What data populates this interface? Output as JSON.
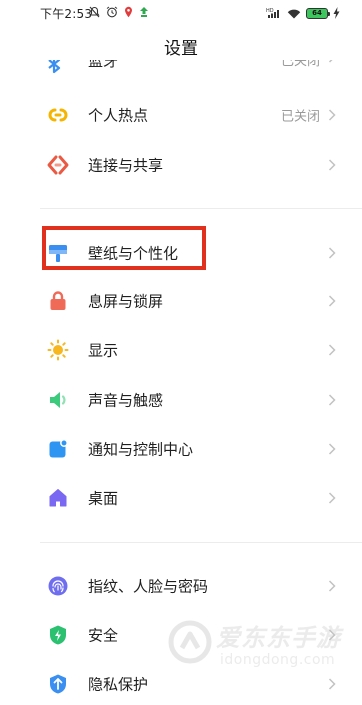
{
  "status_bar": {
    "time": "下午2:53",
    "battery": "64",
    "network": "HD"
  },
  "header": {
    "title": "设置"
  },
  "partial_row": {
    "label": "蓝牙",
    "value": "已关闭"
  },
  "rows": [
    {
      "label": "个人热点",
      "value": "已关闭",
      "icon": "hotspot-icon",
      "color": "#f5b400"
    },
    {
      "label": "连接与共享",
      "value": "",
      "icon": "connection-share-icon",
      "color": "#ea5a42"
    },
    {
      "label": "壁纸与个性化",
      "value": "",
      "icon": "wallpaper-icon",
      "color": "#3a8ff0"
    },
    {
      "label": "息屏与锁屏",
      "value": "",
      "icon": "lock-icon",
      "color": "#f06a58"
    },
    {
      "label": "显示",
      "value": "",
      "icon": "sun-icon",
      "color": "#f7b720"
    },
    {
      "label": "声音与触感",
      "value": "",
      "icon": "speaker-icon",
      "color": "#3ccb7c"
    },
    {
      "label": "通知与控制中心",
      "value": "",
      "icon": "notification-icon",
      "color": "#2f95f3"
    },
    {
      "label": "桌面",
      "value": "",
      "icon": "home-icon",
      "color": "#7a68f2"
    },
    {
      "label": "指纹、人脸与密码",
      "value": "",
      "icon": "fingerprint-icon",
      "color": "#6f6ef0"
    },
    {
      "label": "安全",
      "value": "",
      "icon": "shield-icon",
      "color": "#2cc071"
    },
    {
      "label": "隐私保护",
      "value": "",
      "icon": "privacy-icon",
      "color": "#3a8ff0"
    }
  ],
  "highlight": {
    "color": "#e0301e"
  },
  "watermark": {
    "text": "爱东东手游",
    "url": "idongdong.com"
  }
}
